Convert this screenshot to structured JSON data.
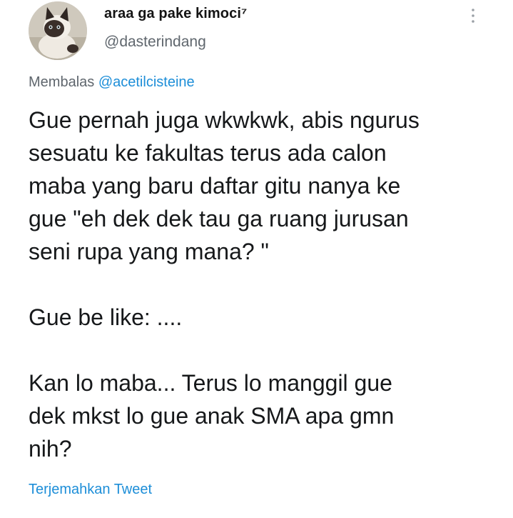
{
  "tweet": {
    "display_name": "araa ga pake kimoci⁷",
    "handle": "@dasterindang",
    "reply_prefix": "Membalas",
    "reply_to": "@acetilcisteine",
    "paragraphs": [
      "Gue pernah juga wkwkwk, abis ngurus\nsesuatu ke fakultas terus ada calon\nmaba yang baru daftar gitu nanya ke\ngue \"eh dek dek tau ga ruang jurusan\nseni rupa yang mana? \"",
      "Gue be like: ....",
      "Kan lo maba... Terus lo manggil gue\ndek mkst lo gue anak SMA apa gmn\nnih?"
    ],
    "translate_label": "Terjemahkan Tweet"
  },
  "icons": {
    "avatar": "cat-photo-avatar",
    "menu": "more-vertical-icon"
  },
  "colors": {
    "link": "#1d8ed8",
    "secondary_text": "#5f666d",
    "primary_text": "#16181a",
    "background": "#ffffff"
  }
}
